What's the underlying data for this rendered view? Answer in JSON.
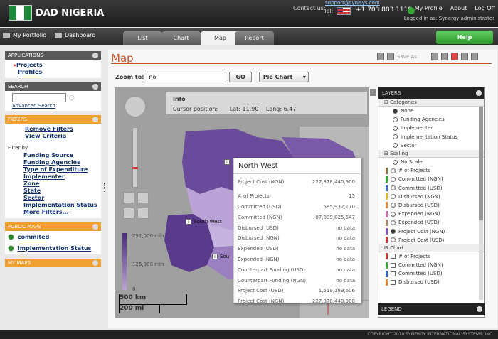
{
  "brand": {
    "title": "DAD NIGERIA",
    "flag_colors": [
      "#1a8a3a",
      "#ffffff",
      "#1a8a3a"
    ]
  },
  "header": {
    "contact_label": "Contact us:",
    "support_email": "support@synisys.com",
    "tel_label": "Tel:",
    "phone": "+1 703 883 1119",
    "links": [
      "My Profile",
      "About",
      "Log Off"
    ],
    "logged_in": "Logged in as: Synergy administrator"
  },
  "nav": {
    "my_portfolio": "My Portfolio",
    "dashboard": "Dashboard",
    "tabs": [
      "List",
      "Chart",
      "Map",
      "Report"
    ],
    "active_tab": "Map",
    "help": "Help"
  },
  "sidebar": {
    "applications": {
      "title": "APPLICATIONS",
      "items": [
        "Projects",
        "Profiles"
      ]
    },
    "search": {
      "title": "SEARCH",
      "advanced": "Advanced Search",
      "placeholder": ""
    },
    "filters": {
      "title": "FILTERS",
      "remove": "Remove Filters",
      "view": "View Criteria",
      "filter_by": "Filter by:",
      "items": [
        "Funding Source",
        "Funding Agencies",
        "Type of Expenditure",
        "Implementer",
        "Zone",
        "State",
        "Sector",
        "Implementation Status",
        "More Filters..."
      ]
    },
    "public_maps": {
      "title": "PUBLIC MAPS",
      "items": [
        "commited",
        "Implementation Status"
      ]
    },
    "my_maps": {
      "title": "MY MAPS"
    }
  },
  "main": {
    "title": "Map",
    "save_as": "Save As",
    "zoom_label": "Zoom to:",
    "zoom_value": "no",
    "go": "GO",
    "chart_type": "Pie Chart"
  },
  "map": {
    "info_label": "Info",
    "cursor_label": "Cursor position:",
    "lat_label": "Lat:",
    "lat": "11.90",
    "long_label": "Long:",
    "long": "6.47",
    "legend": [
      "251,000 mln",
      "126,000 mln",
      "0"
    ],
    "scale_km": "500 km",
    "scale_mi": "200 mi",
    "labels": [
      "South West",
      "Sou"
    ],
    "popup": {
      "title": "North West",
      "rows": [
        [
          "Project Cost (NGN)",
          "227,878,440,900"
        ],
        [
          "# of Projects",
          "15"
        ],
        [
          "Committed (USD)",
          "585,932,170"
        ],
        [
          "Committed (NGN)",
          "87,889,825,547"
        ],
        [
          "Disbursed (USD)",
          "no data"
        ],
        [
          "Disbursed (NGN)",
          "no data"
        ],
        [
          "Expended (USD)",
          "no data"
        ],
        [
          "Expended (NGN)",
          "no data"
        ],
        [
          "Counterpart Funding (USD)",
          "no data"
        ],
        [
          "Counterpart Funding (NGN)",
          "no data"
        ],
        [
          "Project Cost (USD)",
          "1,519,189,606"
        ],
        [
          "Project Cost (NGN)",
          "227,878,440,900"
        ]
      ]
    }
  },
  "layers": {
    "title": "LAYERS",
    "legend_title": "LEGEND",
    "categories": {
      "title": "Categories",
      "items": [
        "None",
        "Funding Agencies",
        "Implementer",
        "Implementation Status",
        "Sector"
      ],
      "selected": "None"
    },
    "scaling": {
      "title": "Scaling",
      "items": [
        "No Scale",
        "# of Projects",
        "Committed (NGN)",
        "Committed (USD)",
        "Disbursed (NGN)",
        "Disbursed (USD)",
        "Expended (NGN)",
        "Expended (USD)",
        "Project Cost (NGN)",
        "Project Cost (USD)"
      ],
      "selected": "Project Cost (NGN)"
    },
    "chart": {
      "title": "Chart",
      "items": [
        "# of Projects",
        "Committed (NGN)",
        "Committed (USD)",
        "Disbursed (USD)"
      ]
    }
  },
  "footer": "COPYRIGHT 2010 SYNERGY INTERNATIONAL SYSTEMS, INC."
}
